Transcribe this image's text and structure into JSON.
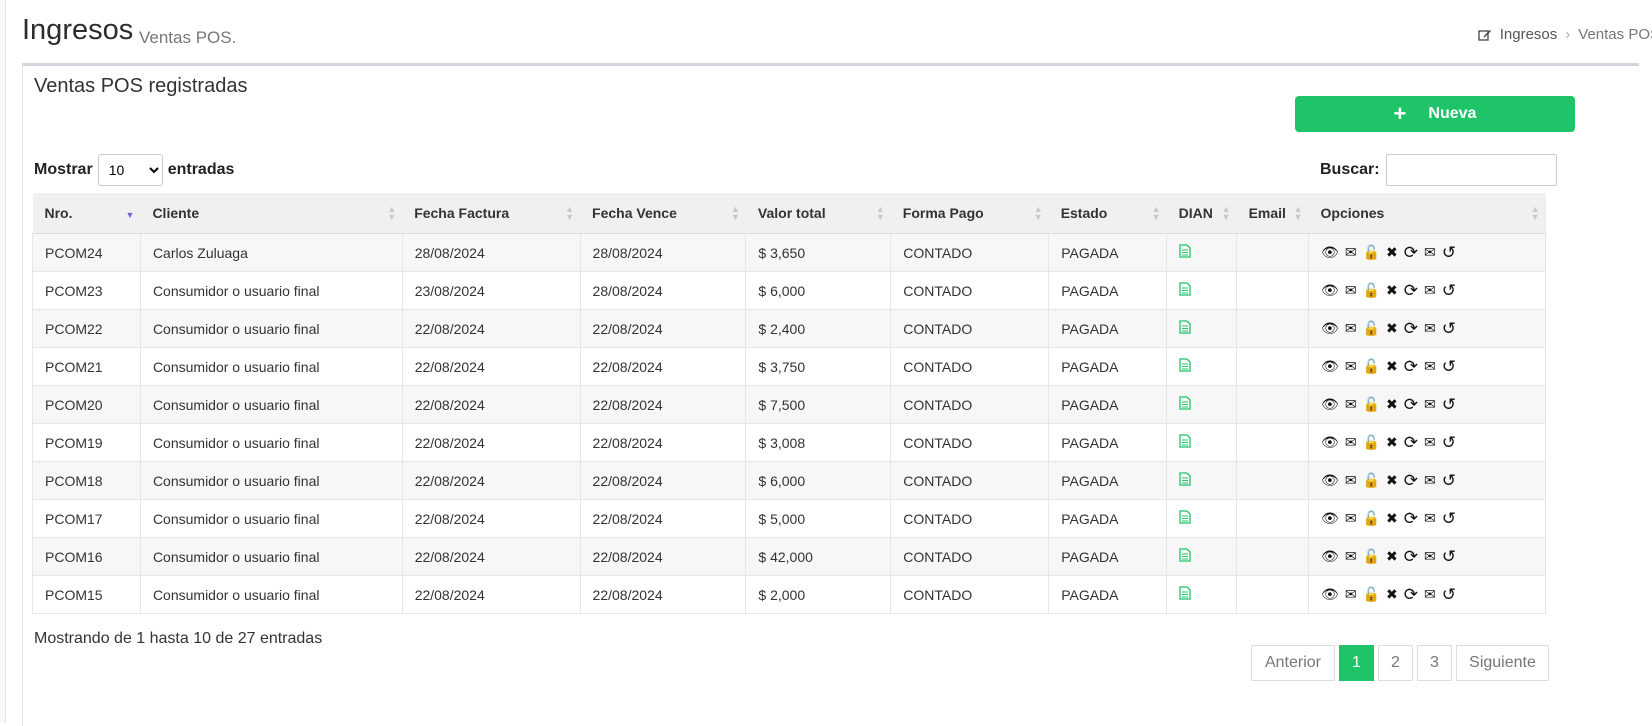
{
  "header": {
    "title": "Ingresos",
    "subtitle": "Ventas POS.",
    "breadcrumb": {
      "root": "Ingresos",
      "separator": "›",
      "current": "Ventas POS"
    }
  },
  "box": {
    "title": "Ventas POS registradas",
    "new_button": {
      "icon": "+",
      "label": "Nueva"
    }
  },
  "controls": {
    "show_label": "Mostrar",
    "entries_value": "10",
    "entries_label": "entradas",
    "search_label": "Buscar:",
    "search_value": ""
  },
  "table": {
    "columns": [
      "Nro.",
      "Cliente",
      "Fecha Factura",
      "Fecha Vence",
      "Valor total",
      "Forma Pago",
      "Estado",
      "DIAN",
      "Email",
      "Opciones"
    ],
    "rows": [
      {
        "nro": "PCOM24",
        "cliente": "Carlos Zuluaga",
        "fecha_factura": "28/08/2024",
        "fecha_vence": "28/08/2024",
        "valor": "$ 3,650",
        "forma_pago": "CONTADO",
        "estado": "PAGADA"
      },
      {
        "nro": "PCOM23",
        "cliente": "Consumidor o usuario final",
        "fecha_factura": "23/08/2024",
        "fecha_vence": "28/08/2024",
        "valor": "$ 6,000",
        "forma_pago": "CONTADO",
        "estado": "PAGADA"
      },
      {
        "nro": "PCOM22",
        "cliente": "Consumidor o usuario final",
        "fecha_factura": "22/08/2024",
        "fecha_vence": "22/08/2024",
        "valor": "$ 2,400",
        "forma_pago": "CONTADO",
        "estado": "PAGADA"
      },
      {
        "nro": "PCOM21",
        "cliente": "Consumidor o usuario final",
        "fecha_factura": "22/08/2024",
        "fecha_vence": "22/08/2024",
        "valor": "$ 3,750",
        "forma_pago": "CONTADO",
        "estado": "PAGADA"
      },
      {
        "nro": "PCOM20",
        "cliente": "Consumidor o usuario final",
        "fecha_factura": "22/08/2024",
        "fecha_vence": "22/08/2024",
        "valor": "$ 7,500",
        "forma_pago": "CONTADO",
        "estado": "PAGADA"
      },
      {
        "nro": "PCOM19",
        "cliente": "Consumidor o usuario final",
        "fecha_factura": "22/08/2024",
        "fecha_vence": "22/08/2024",
        "valor": "$ 3,008",
        "forma_pago": "CONTADO",
        "estado": "PAGADA"
      },
      {
        "nro": "PCOM18",
        "cliente": "Consumidor o usuario final",
        "fecha_factura": "22/08/2024",
        "fecha_vence": "22/08/2024",
        "valor": "$ 6,000",
        "forma_pago": "CONTADO",
        "estado": "PAGADA"
      },
      {
        "nro": "PCOM17",
        "cliente": "Consumidor o usuario final",
        "fecha_factura": "22/08/2024",
        "fecha_vence": "22/08/2024",
        "valor": "$ 5,000",
        "forma_pago": "CONTADO",
        "estado": "PAGADA"
      },
      {
        "nro": "PCOM16",
        "cliente": "Consumidor o usuario final",
        "fecha_factura": "22/08/2024",
        "fecha_vence": "22/08/2024",
        "valor": "$ 42,000",
        "forma_pago": "CONTADO",
        "estado": "PAGADA"
      },
      {
        "nro": "PCOM15",
        "cliente": "Consumidor o usuario final",
        "fecha_factura": "22/08/2024",
        "fecha_vence": "22/08/2024",
        "valor": "$ 2,000",
        "forma_pago": "CONTADO",
        "estado": "PAGADA"
      }
    ],
    "option_icons": [
      "eye-icon",
      "envelope-icon",
      "unlock-icon",
      "close-icon",
      "refresh-icon",
      "envelope-open-icon",
      "history-icon"
    ],
    "dian_icon": "file-text-icon"
  },
  "footer": {
    "info": "Mostrando de 1 hasta 10 de 27 entradas",
    "pagination": {
      "previous": "Anterior",
      "pages": [
        "1",
        "2",
        "3"
      ],
      "active_page": "1",
      "next": "Siguiente"
    }
  },
  "colors": {
    "accent": "#1fc468",
    "sort_active": "#6a6ad8",
    "header_bg": "#f0f0f0",
    "stripe": "#f7f7f7"
  }
}
